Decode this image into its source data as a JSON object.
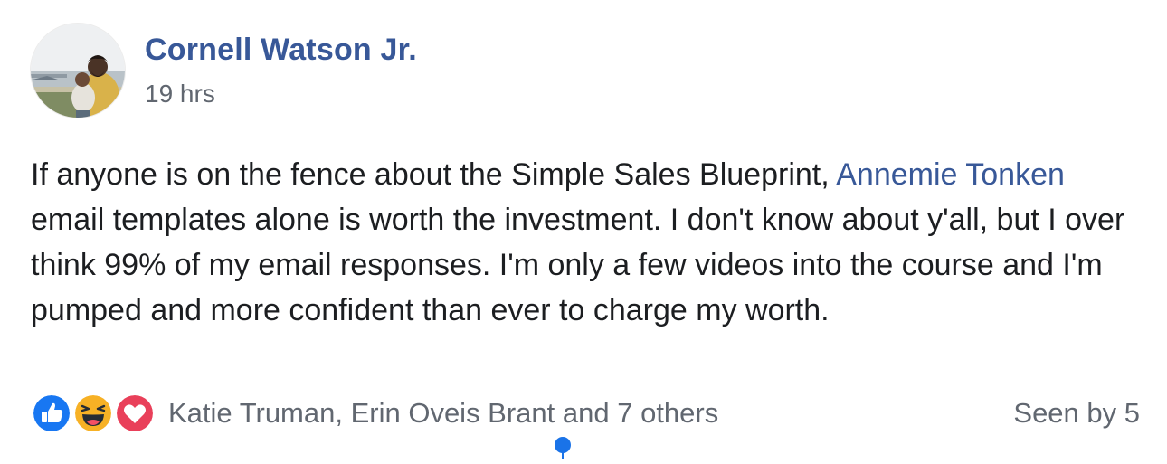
{
  "post": {
    "author": {
      "name": "Cornell Watson Jr.",
      "timestamp": "19 hrs",
      "avatar_icon": "profile-photo"
    },
    "body": {
      "text_before": "If anyone is on the fence about the Simple Sales Blueprint, ",
      "mention": "Annemie Tonken",
      "text_after": " email templates alone is worth the investment. I don't know about y'all, but I over think 99% of my email responses. I'm only a few videos into the course and I'm pumped and more confident than ever to charge my worth."
    },
    "reactions": {
      "icons": [
        "like-icon",
        "haha-icon",
        "love-icon"
      ],
      "summary": "Katie Truman, Erin Oveis Brant and 7 others"
    },
    "seen_by": "Seen by 5"
  },
  "colors": {
    "link_blue": "#385898",
    "secondary_text": "#616770",
    "body_text": "#1c1e21",
    "like_blue": "#1877f2",
    "haha_yellow": "#f7b125",
    "love_red": "#e9405a",
    "cursor_blue": "#1a73e8"
  }
}
